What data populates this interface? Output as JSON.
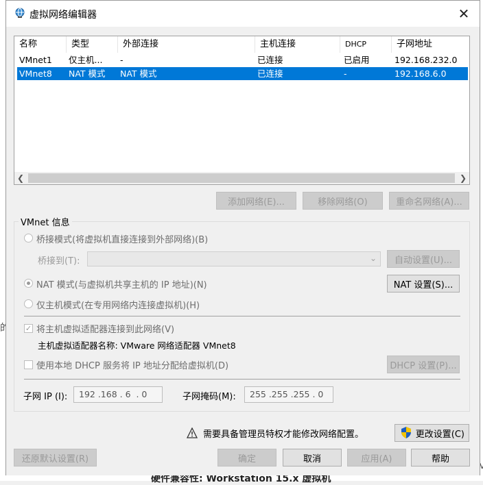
{
  "background": {
    "left_fragment": "的",
    "bottom_text": "硬件兼容性:  Workstation 15.x 虚拟机",
    "right_fragment": "ev"
  },
  "dialog": {
    "title": "虚拟网络编辑器",
    "close_label": "✕"
  },
  "table": {
    "columns": [
      "名称",
      "类型",
      "外部连接",
      "主机连接",
      "DHCP",
      "子网地址"
    ],
    "rows": [
      [
        "VMnet1",
        "仅主机...",
        "-",
        "已连接",
        "已启用",
        "192.168.232.0"
      ],
      [
        "VMnet8",
        "NAT 模式",
        "NAT 模式",
        "已连接",
        "-",
        "192.168.6.0"
      ]
    ],
    "selected_row": 1
  },
  "list_buttons": {
    "add": "添加网络(E)...",
    "remove": "移除网络(O)",
    "rename": "重命名网络(A)..."
  },
  "vmnet_info": {
    "title": "VMnet 信息",
    "bridge_mode": "桥接模式(将虚拟机直接连接到外部网络)(B)",
    "bridge_to_label": "桥接到(T):",
    "bridge_to_value": "",
    "auto_settings": "自动设置(U)...",
    "nat_mode": "NAT 模式(与虚拟机共享主机的 IP 地址)(N)",
    "nat_settings": "NAT 设置(S)...",
    "host_only_mode": "仅主机模式(在专用网络内连接虚拟机)(H)",
    "connect_adapter": "将主机虚拟适配器连接到此网络(V)",
    "adapter_name_label": "主机虚拟适配器名称: VMware 网络适配器 VMnet8",
    "use_dhcp": "使用本地 DHCP 服务将 IP 地址分配给虚拟机(D)",
    "dhcp_settings": "DHCP 设置(P)...",
    "subnet_ip_label": "子网 IP (I):",
    "subnet_ip_value": "192 .168 . 6  . 0",
    "subnet_mask_label": "子网掩码(M):",
    "subnet_mask_value": "255 .255 .255 . 0",
    "selected_mode": "nat",
    "connect_adapter_checked": true,
    "use_dhcp_checked": false
  },
  "admin": {
    "warning": "需要具备管理员特权才能修改网络配置。",
    "change_settings": "更改设置(C)"
  },
  "footer": {
    "restore_defaults": "还原默认设置(R)",
    "ok": "确定",
    "cancel": "取消",
    "apply": "应用(A)",
    "help": "帮助"
  },
  "colors": {
    "selection": "#0078d7",
    "shield_blue": "#1e5fbf",
    "shield_yellow": "#f5c400"
  }
}
